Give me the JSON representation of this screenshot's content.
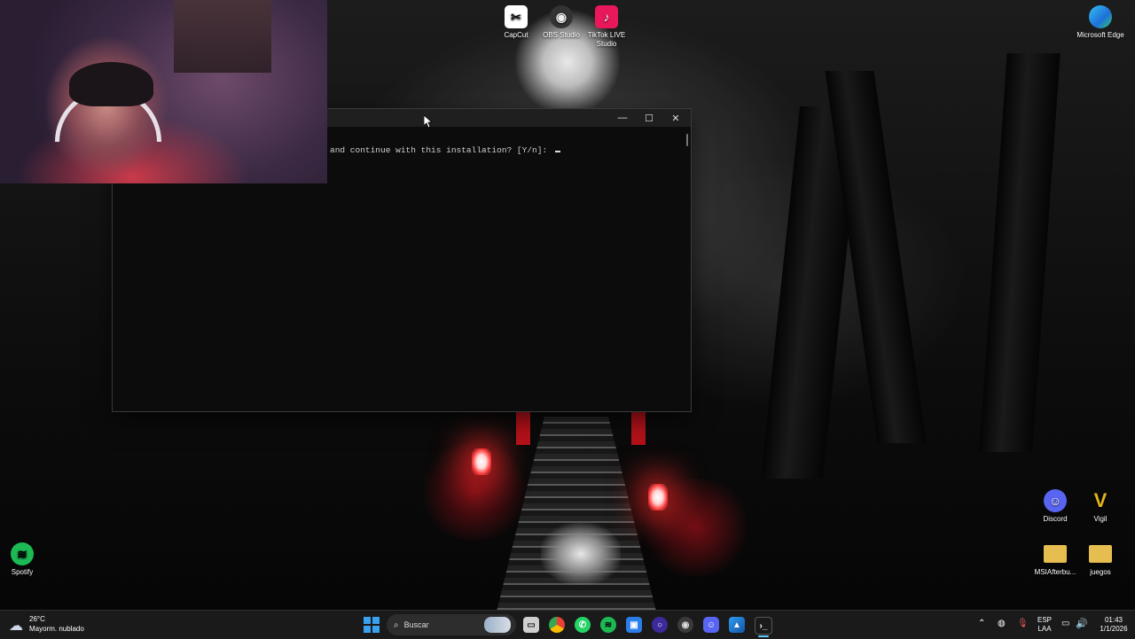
{
  "desktop": {
    "icons": [
      {
        "label": "CapCut",
        "color": "#111111"
      },
      {
        "label": "OBS Studio",
        "color": "#2c2c2c"
      },
      {
        "label": "TikTok LIVE Studio",
        "color": "#e8185a"
      },
      {
        "label": "Microsoft Edge",
        "color": "#1e8fd8"
      },
      {
        "label": "Discord",
        "color": "#5865f2"
      },
      {
        "label": "Vigil",
        "color": "#d4a516"
      },
      {
        "label": "Spotify",
        "color": "#1db954"
      },
      {
        "label": "MSIAfterbu...",
        "color": "#e0b84a"
      },
      {
        "label": "juegos",
        "color": "#e0b84a"
      }
    ]
  },
  "terminal": {
    "prompt_text": "and continue with this installation? [Y/n]: "
  },
  "taskbar": {
    "weather": {
      "temp": "26°C",
      "desc": "Mayorm. nublado"
    },
    "search_placeholder": "Buscar",
    "language": {
      "line1": "ESP",
      "line2": "LAA"
    },
    "clock": {
      "time": "01:43",
      "date": "1/1/2026"
    }
  }
}
